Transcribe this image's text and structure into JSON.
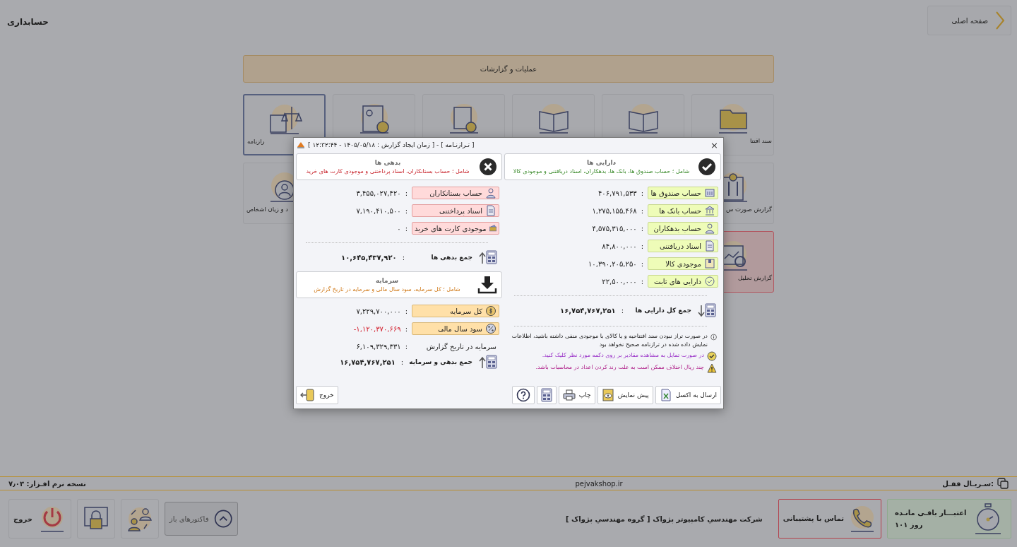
{
  "header": {
    "title": "حسابداری",
    "home_button": "صفحه اصلی"
  },
  "banner": "عملیات و گزارشات",
  "tile_rows": [
    [
      {
        "label": "سند افتتا",
        "selected": false,
        "kind": "normal"
      },
      {
        "selected": false,
        "kind": "normal"
      },
      {
        "selected": false,
        "kind": "normal"
      },
      {
        "selected": false,
        "kind": "normal"
      },
      {
        "selected": false,
        "kind": "normal"
      },
      {
        "label": "رازنامه",
        "selected": true,
        "kind": "normal"
      }
    ],
    [
      {
        "label": "گزارش صورت س",
        "selected": false,
        "kind": "normal"
      },
      {
        "label": "د و زیان اشخاص",
        "selected": false,
        "kind": "normal"
      }
    ],
    [
      {
        "label": "گزارش تحلیل",
        "selected": false,
        "kind": "alert"
      }
    ]
  ],
  "dialog": {
    "title": "[ تـرازنـامه ] - [ زمان ایجاد گزارش : ۱۴۰۵/۰۵/۱۸ - ۱۲:۳۲:۴۴ ]",
    "assets": {
      "kind": "assets",
      "title": "دارایی ها",
      "subtitle": "شامل ؛ حساب صندوق ها، بانک ها، بدهکاران، اسناد دریافتنی و موجودی کالا",
      "rows": [
        {
          "kind": "chip",
          "label": "حساب صندوق ها",
          "value": "۴۰۶,۷۹۱,۵۳۳",
          "negative": false
        },
        {
          "kind": "chip",
          "label": "حساب بانک ها",
          "value": "۱,۲۷۵,۱۵۵,۴۶۸",
          "negative": false
        },
        {
          "kind": "chip",
          "label": "حساب بدهکاران",
          "value": "۴,۵۷۵,۳۱۵,۰۰۰",
          "negative": false
        },
        {
          "kind": "chip",
          "label": "اسناد دریافتنی",
          "value": "۸۴,۸۰۰,۰۰۰",
          "negative": false
        },
        {
          "kind": "chip",
          "label": "موجودی کالا",
          "value": "۱۰,۳۹۰,۲۰۵,۲۵۰",
          "negative": false
        },
        {
          "kind": "chip",
          "label": "دارایی های ثابت",
          "value": "۲۲,۵۰۰,۰۰۰",
          "negative": false
        }
      ],
      "total": {
        "label": "جمع کل دارایی ها",
        "value": "۱۶,۷۵۴,۷۶۷,۲۵۱"
      },
      "notes": [
        {
          "kind": "info",
          "text": "در صورت تراز نبودن سند افتتاحیه و یا کالای با موجودی منفی داشته باشید، اطلاعات نمایش داده شده در ترازنامه صحیح نخواهد بود"
        },
        {
          "kind": "tip",
          "text": "در صورت تمایل به مشاهده مقادیر بر روی دکمه مورد نظر کلیک کنید."
        },
        {
          "kind": "warning",
          "text": "چند ریال اختلاف ممکن است به علت رند کردن اعداد در محاسبات باشد."
        }
      ]
    },
    "liabilities": {
      "kind": "liabilities",
      "title": "بدهی ها",
      "subtitle": "شامل ؛ حساب بستانکاران، اسناد پرداختنی و موجودی کارت های خرید",
      "rows": [
        {
          "kind": "chip",
          "label": "حساب بستانکاران",
          "value": "۳,۴۵۵,۰۲۷,۴۲۰",
          "negative": false
        },
        {
          "kind": "chip",
          "label": "اسناد پرداختنی",
          "value": "۷,۱۹۰,۴۱۰,۵۰۰",
          "negative": false
        },
        {
          "kind": "chip",
          "label": "موجودی کارت های خرید",
          "value": "۰",
          "negative": false
        }
      ],
      "total": {
        "label": "جمع بدهی ها",
        "value": "۱۰,۶۴۵,۴۳۷,۹۲۰"
      }
    },
    "capital": {
      "kind": "capital",
      "title": "سرمایه",
      "subtitle": "شامل ؛ کل سرمایه، سود سال مالی و سرمایه در تاریخ گزارش",
      "rows": [
        {
          "kind": "chip",
          "label": "کل سرمایه",
          "value": "۷,۲۲۹,۷۰۰,۰۰۰",
          "negative": false
        },
        {
          "kind": "chip",
          "label": "سود سال مالی",
          "value": "-۱,۱۲۰,۳۷۰,۶۶۹",
          "negative": true
        },
        {
          "kind": "plain",
          "label": "سرمایه در تاریخ گزارش",
          "value": "۶,۱۰۹,۳۲۹,۳۳۱",
          "negative": false
        }
      ],
      "total": {
        "label": "جمع بدهی و سرمایه",
        "value": "۱۶,۷۵۴,۷۶۷,۲۵۱"
      }
    },
    "close_label": "×",
    "separator": ":",
    "buttons": [
      "ارسال به اکسل",
      "پیش نمایش",
      "چاپ"
    ],
    "exit_button": "خروج"
  },
  "status_bar": {
    "version": "نسخه نرم افـزار: ۷٫۰۳",
    "website": "pejvakshop.ir",
    "serial": "سـریـال قفـل:"
  },
  "footer": {
    "exit": "خروج",
    "open_invoices": "فاکتورهای باز",
    "company": "شرکت مهندسي کامپیوتر پژواک [ گروه مهندسي پژواک ]",
    "support": "تماس با پشتیبانی",
    "credit_title": "اعتبـــار باقـی مانـده",
    "credit_days": "۱۰۱ روز"
  }
}
